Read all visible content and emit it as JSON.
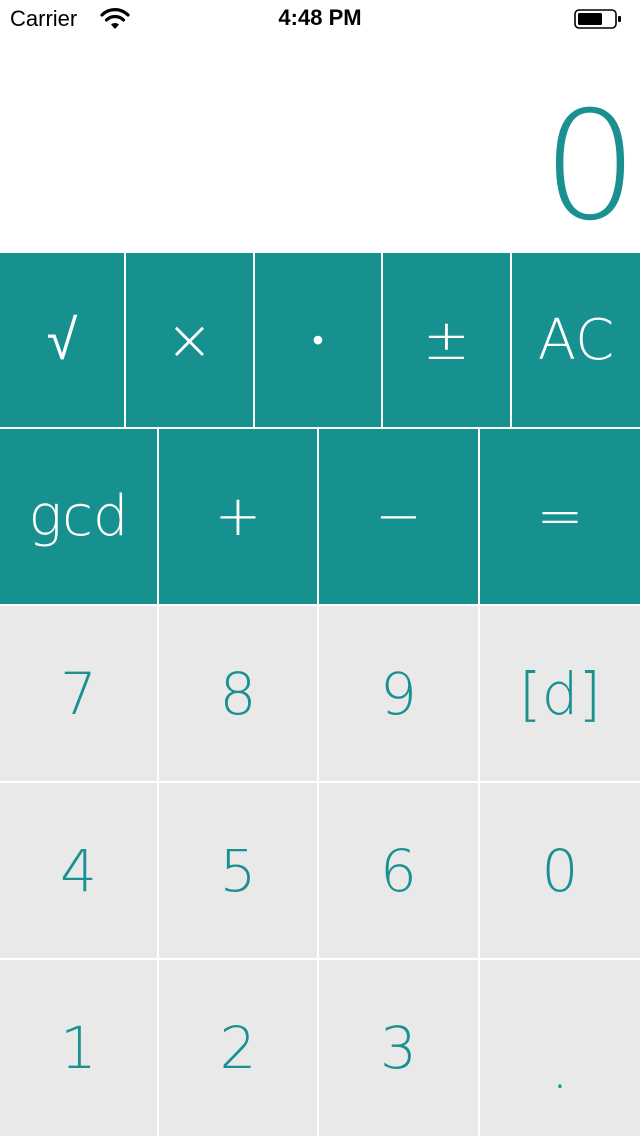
{
  "status_bar": {
    "carrier": "Carrier",
    "time": "4:48 PM"
  },
  "display": {
    "value": "0"
  },
  "keys": {
    "row1": [
      "√",
      "×",
      "•",
      "±",
      "AC"
    ],
    "row2": [
      "gcd",
      "+",
      "−",
      "="
    ],
    "row3": [
      "7",
      "8",
      "9",
      "[d]"
    ],
    "row4": [
      "4",
      "5",
      "6",
      "0"
    ],
    "row5": [
      "1",
      "2",
      "3",
      "."
    ]
  },
  "colors": {
    "accent": "#17918f",
    "number_key_bg": "#e9e9e9",
    "display_text": "#1a9190"
  }
}
